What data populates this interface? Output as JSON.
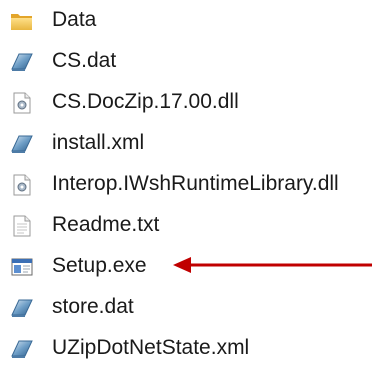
{
  "files": [
    {
      "name": "Data",
      "icon": "folder-icon"
    },
    {
      "name": "CS.dat",
      "icon": "data-file-icon"
    },
    {
      "name": "CS.DocZip.17.00.dll",
      "icon": "dll-file-icon"
    },
    {
      "name": "install.xml",
      "icon": "data-file-icon"
    },
    {
      "name": "Interop.IWshRuntimeLibrary.dll",
      "icon": "dll-file-icon"
    },
    {
      "name": "Readme.txt",
      "icon": "text-file-icon"
    },
    {
      "name": "Setup.exe",
      "icon": "application-icon"
    },
    {
      "name": "store.dat",
      "icon": "data-file-icon"
    },
    {
      "name": "UZipDotNetState.xml",
      "icon": "data-file-icon"
    }
  ],
  "annotation": {
    "arrow_color": "#c00000",
    "points_to": "Setup.exe"
  }
}
